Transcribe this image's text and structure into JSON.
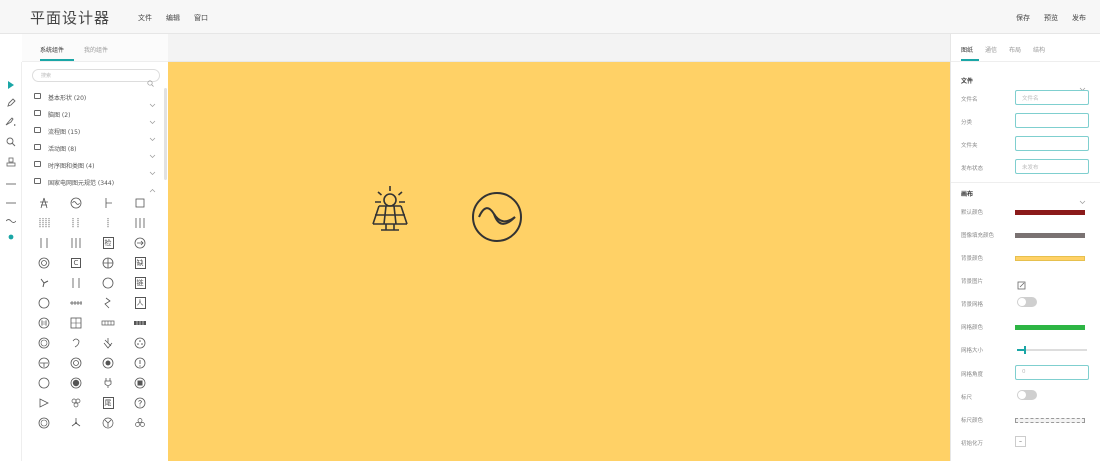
{
  "app": {
    "title": "平面设计器",
    "menu": [
      "文件",
      "编辑",
      "窗口"
    ],
    "actions": [
      "保存",
      "预览",
      "发布"
    ]
  },
  "left_panel": {
    "tabs": [
      "系统组件",
      "我的组件"
    ],
    "search_placeholder": "搜索",
    "categories": [
      {
        "label": "基本形状 (20)",
        "expanded": false
      },
      {
        "label": "脑图 (2)",
        "expanded": false
      },
      {
        "label": "流程图 (15)",
        "expanded": false
      },
      {
        "label": "活动图 (8)",
        "expanded": false
      },
      {
        "label": "时序图和类图 (4)",
        "expanded": false
      },
      {
        "label": "国家电网图元规范 (344)",
        "expanded": true
      }
    ],
    "symbol_texts": {
      "check": "检",
      "lack": "缺",
      "link": "链",
      "person": "人",
      "end": "尾"
    }
  },
  "tools": [
    "pointer-icon",
    "pen-icon",
    "brush-icon",
    "magnify-icon",
    "stamp-icon",
    "line-icon",
    "dash-line-icon",
    "wave-line-icon",
    "dot-icon"
  ],
  "canvas": {
    "background": "#ffd166",
    "items": [
      "solar-panel-icon",
      "ac-source-icon"
    ]
  },
  "right_panel": {
    "tabs": [
      "图纸",
      "通信",
      "布局",
      "结构"
    ],
    "file_section": {
      "title": "文件",
      "fields": [
        {
          "label": "文件名",
          "placeholder": "文件名"
        },
        {
          "label": "分类",
          "placeholder": ""
        },
        {
          "label": "文件夹",
          "placeholder": ""
        },
        {
          "label": "发布状态",
          "placeholder": "未发布"
        }
      ]
    },
    "canvas_section": {
      "title": "画布",
      "default_color_label": "默认颜色",
      "default_color": "#8b1a1a",
      "bg_fill_color_label": "图像填充颜色",
      "bg_fill_color": "#7a7272",
      "bg_color_label": "背景颜色",
      "bg_color": "#ffd166",
      "bg_image_label": "背景图片",
      "bg_grid_label": "背景网格",
      "grid_color_label": "网格颜色",
      "grid_color": "#2db544",
      "grid_size_label": "网格大小",
      "grid_size_value": 0.1,
      "grid_angle_label": "网格角度",
      "grid_angle_value": "0",
      "ruler_label": "标尺",
      "ruler_color_label": "标尺颜色",
      "init_label": "初始化万",
      "minus": "–"
    }
  }
}
